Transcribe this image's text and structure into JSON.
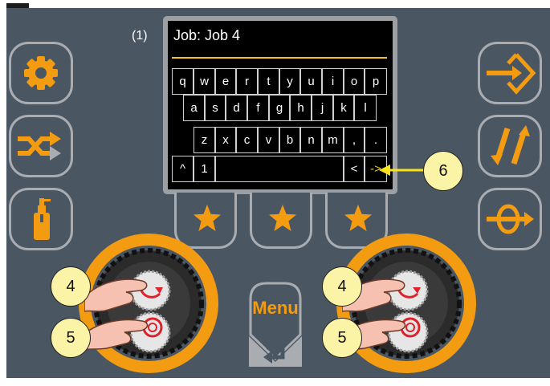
{
  "screen": {
    "annotation_label": "(1)",
    "job_title": "Job: Job 4",
    "keyboard": {
      "row1": [
        "q",
        "w",
        "e",
        "r",
        "t",
        "y",
        "u",
        "i",
        "o",
        "p"
      ],
      "row2": [
        "a",
        "s",
        "d",
        "f",
        "g",
        "h",
        "j",
        "k",
        "l"
      ],
      "row3": [
        "z",
        "x",
        "c",
        "v",
        "b",
        "n",
        "m",
        ",",
        "."
      ],
      "row4": {
        "shift": "^",
        "number": "1",
        "backspace": "<",
        "next": "->"
      }
    }
  },
  "menu_button": {
    "label": "Menu"
  },
  "callouts": {
    "left_turn": "4",
    "left_press": "5",
    "right_turn": "4",
    "right_press": "5",
    "next_key": "6"
  },
  "icons": {
    "left_buttons": [
      "gear-icon",
      "shuffle-icon",
      "spray-can-icon"
    ],
    "right_buttons": [
      "diamond-arrow-icon",
      "double-slash-arrow-icon",
      "loop-arrow-icon"
    ],
    "soft_keys": [
      "star-icon",
      "star-icon",
      "star-icon"
    ]
  },
  "colors": {
    "panel": "#4b5663",
    "accent": "#f39c12",
    "highlight": "#f7c321",
    "screen": "#000000",
    "callout": "#fbf3a6"
  }
}
